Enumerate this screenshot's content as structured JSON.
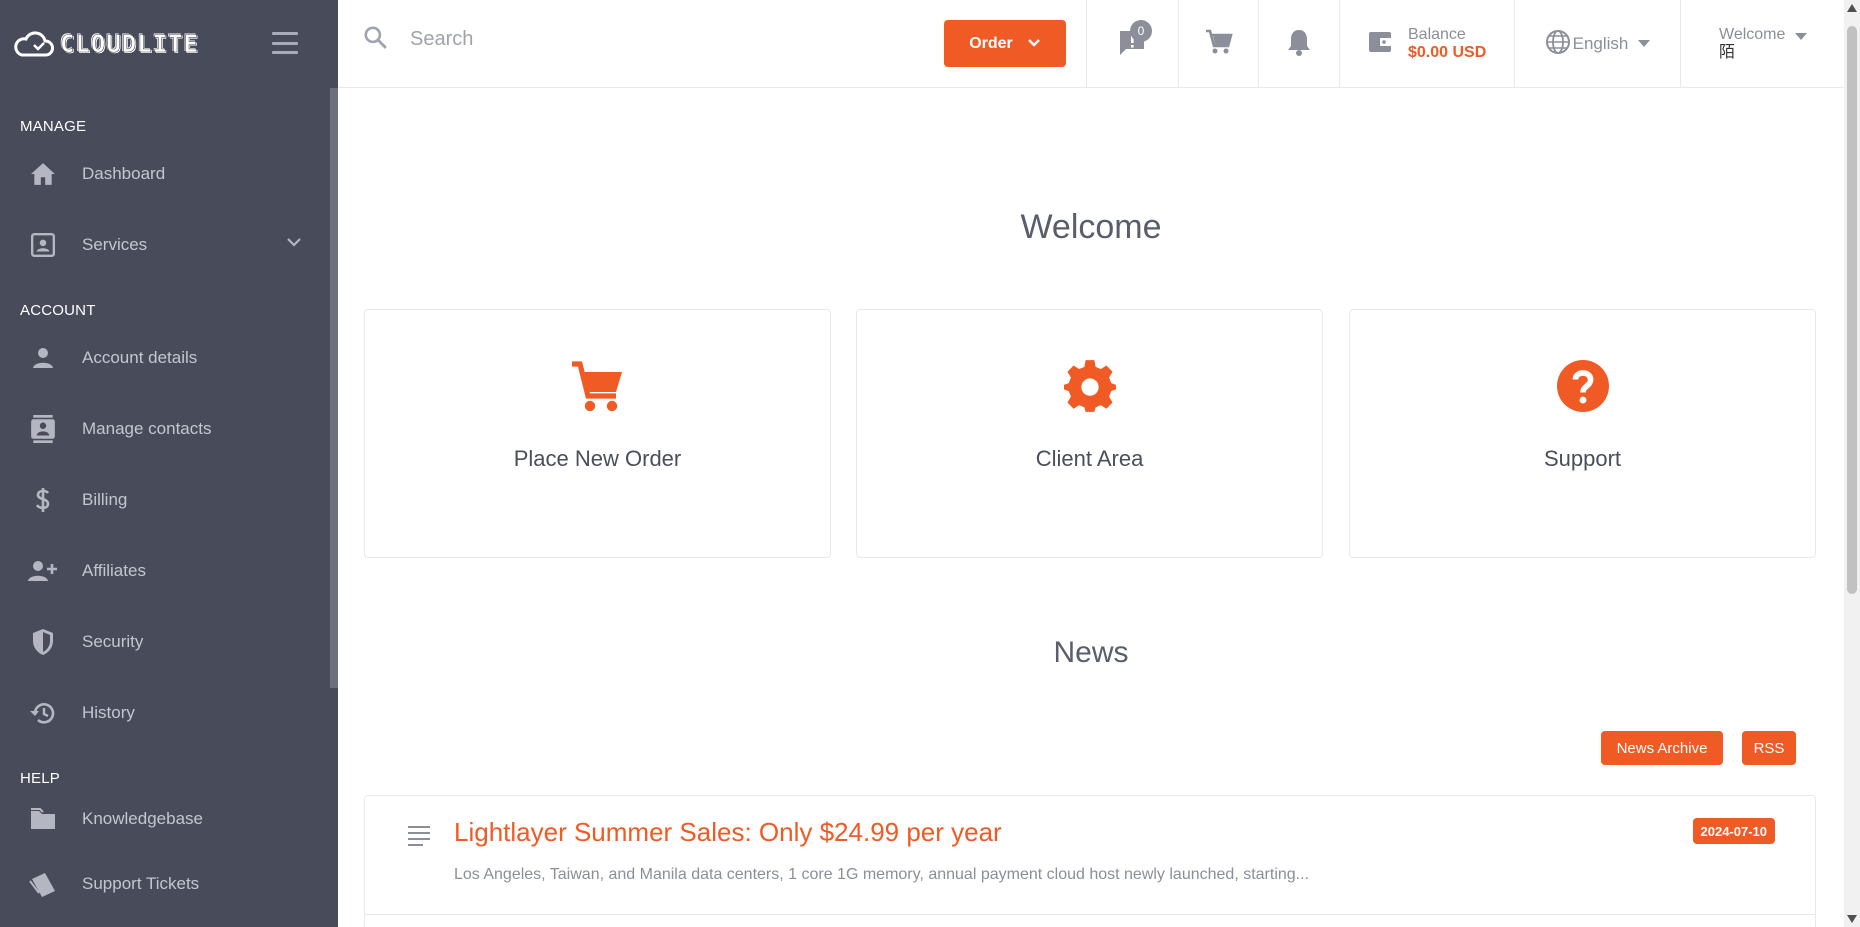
{
  "brand": {
    "logo_text": "CLOUDLITE"
  },
  "sidebar": {
    "sections": [
      {
        "title": "MANAGE",
        "items": [
          {
            "label": "Dashboard",
            "icon": "home-icon"
          },
          {
            "label": "Services",
            "icon": "id-card-icon",
            "has_chevron": true
          }
        ]
      },
      {
        "title": "ACCOUNT",
        "items": [
          {
            "label": "Account details",
            "icon": "user-icon"
          },
          {
            "label": "Manage contacts",
            "icon": "contacts-icon"
          },
          {
            "label": "Billing",
            "icon": "dollar-icon"
          },
          {
            "label": "Affiliates",
            "icon": "user-plus-icon"
          },
          {
            "label": "Security",
            "icon": "shield-icon"
          },
          {
            "label": "History",
            "icon": "history-icon"
          }
        ]
      },
      {
        "title": "HELP",
        "items": [
          {
            "label": "Knowledgebase",
            "icon": "book-icon"
          },
          {
            "label": "Support Tickets",
            "icon": "tickets-icon"
          }
        ]
      }
    ]
  },
  "header": {
    "search": {
      "placeholder": "Search"
    },
    "order_label": "Order",
    "messages_count": "0",
    "balance": {
      "label": "Balance",
      "value": "$0.00 USD"
    },
    "language": "English",
    "welcome": {
      "label": "Welcome",
      "name": "陌"
    }
  },
  "main": {
    "welcome_title": "Welcome",
    "cards": [
      {
        "label": "Place New Order",
        "icon": "cart-icon"
      },
      {
        "label": "Client Area",
        "icon": "gear-icon"
      },
      {
        "label": "Support",
        "icon": "help-icon"
      }
    ],
    "news_title": "News",
    "news_archive_label": "News Archive",
    "rss_label": "RSS",
    "news": [
      {
        "title": "Lightlayer Summer Sales: Only $24.99 per year",
        "excerpt": "Los Angeles, Taiwan, and Manila data centers, 1 core 1G memory, annual payment cloud host newly launched, starting...",
        "date": "2024-07-10"
      }
    ]
  },
  "colors": {
    "accent": "#f05a24",
    "sidebar_bg": "#484b5a",
    "muted": "#8c8f9a"
  }
}
